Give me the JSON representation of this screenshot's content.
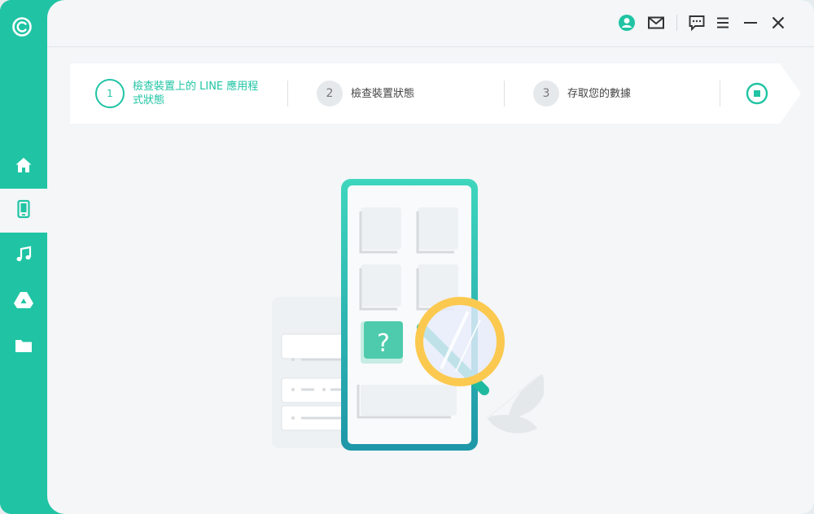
{
  "app": {
    "logo_icon": "app-logo-icon",
    "accent_color": "#20c4a4"
  },
  "sidebar": {
    "items": [
      {
        "name": "home",
        "icon": "home-icon"
      },
      {
        "name": "device",
        "icon": "phone-icon",
        "active": true
      },
      {
        "name": "music",
        "icon": "music-note-icon"
      },
      {
        "name": "drive",
        "icon": "google-drive-icon"
      },
      {
        "name": "folder",
        "icon": "folder-icon"
      }
    ]
  },
  "titlebar": {
    "buttons": [
      "user-icon",
      "mail-icon",
      "feedback-icon",
      "menu-icon",
      "minimize-icon",
      "close-icon"
    ]
  },
  "steps": [
    {
      "number": "1",
      "label": "檢查裝置上的 LINE 應用程式狀態",
      "state": "active"
    },
    {
      "number": "2",
      "label": "檢查裝置狀態",
      "state": "pending"
    },
    {
      "number": "3",
      "label": "存取您的數據",
      "state": "pending"
    }
  ],
  "stop_button": {
    "icon": "stop-icon"
  },
  "illustration": {
    "question_mark": "?",
    "phone_icon": "phone-scan-icon",
    "magnifier_icon": "magnifier-icon"
  }
}
